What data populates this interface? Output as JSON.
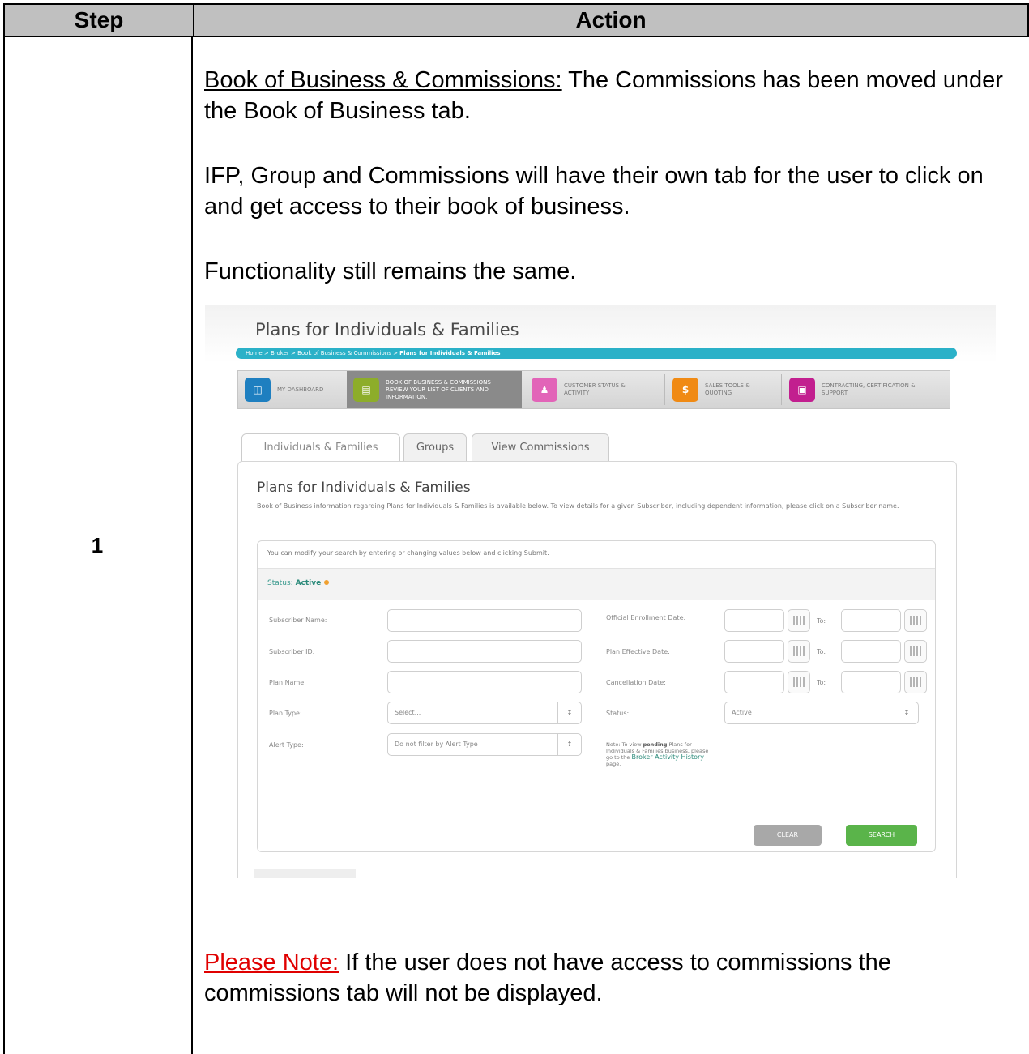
{
  "table": {
    "header_step": "Step",
    "header_action": "Action",
    "step_number": "1"
  },
  "action": {
    "p1_underlined": "Book of Business & Commissions:",
    "p1_text": " The Commissions has been moved under the Book of Business tab.",
    "p2": "IFP, Group and Commissions will have their own tab for the user to click on and get access to their book of business.",
    "p3": "Functionality still remains the same.",
    "note_label": "Please Note:",
    "note_text": " If the user does not have access to commissions the commissions tab will not be displayed."
  },
  "screenshot": {
    "page_title": "Plans for Individuals & Families",
    "breadcrumb_path": "Home > Broker > Book of Business & Commissions > ",
    "breadcrumb_current": "Plans for Individuals & Families",
    "nav": [
      {
        "label": "My Dashboard",
        "icon": "dashboard-icon",
        "color": "#1e7fc0"
      },
      {
        "label": "Book of Business & Commissions Review your list of clients and information.",
        "icon": "book-icon",
        "color": "#8dad2a"
      },
      {
        "label": "Customer Status & Activity",
        "icon": "people-icon",
        "color": "#e264b8"
      },
      {
        "label": "Sales Tools & Quoting",
        "icon": "sales-icon",
        "color": "#f08a14"
      },
      {
        "label": "Contracting, Certification & Support",
        "icon": "certificate-icon",
        "color": "#c21f8f"
      }
    ],
    "tabs": [
      "Individuals & Families",
      "Groups",
      "View Commissions"
    ],
    "panel_title": "Plans for Individuals & Families",
    "panel_description": "Book of Business information regarding Plans for Individuals & Families is available below. To view details for a given Subscriber, including dependent information, please click on a Subscriber name.",
    "search_hint": "You can modify your search by entering or changing values below and clicking Submit.",
    "status_label": "Status: ",
    "status_value": "Active",
    "left_fields": {
      "subscriber_name": "Subscriber Name:",
      "subscriber_id": "Subscriber ID:",
      "plan_name": "Plan Name:",
      "plan_type": "Plan Type:",
      "plan_type_value": "Select...",
      "alert_type": "Alert Type:",
      "alert_type_value": "Do not filter by Alert Type"
    },
    "right_fields": {
      "official_enrollment": "Official Enrollment Date:",
      "plan_effective": "Plan Effective Date:",
      "cancellation": "Cancellation Date:",
      "to": "To:",
      "status": "Status:",
      "status_value": "Active"
    },
    "note_prefix": "Note: To view ",
    "note_bold": "pending",
    "note_middle": " Plans for Individuals & Families business, please go to the ",
    "note_link": "Broker Activity History",
    "note_suffix": " page.",
    "clear_button": "Clear",
    "search_button": "Search"
  }
}
